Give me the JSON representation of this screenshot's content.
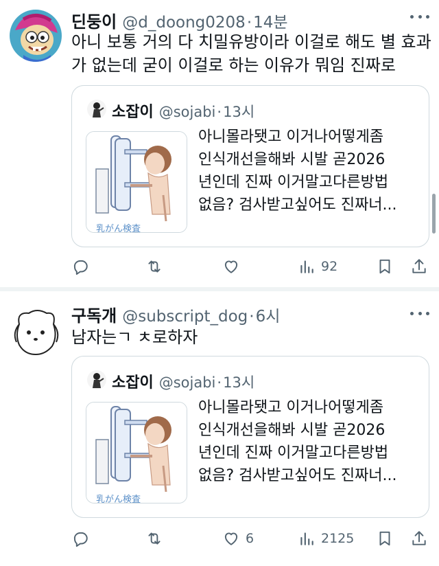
{
  "tweets": [
    {
      "author_name": "딘둥이",
      "handle": "@d_doong0208",
      "separator": "·",
      "time": "14분",
      "text_lines": [
        "아니 보통 거의 다 치밀유방이라 이걸로 해도 별 효과",
        "가 없는데 굳이 이걸로 하는 이유가 뭐임 진짜로"
      ],
      "quote": {
        "author_name": "소잡이",
        "handle": "@sojabi",
        "separator": "·",
        "time": "13시",
        "media_caption": "乳がん検査",
        "text_lines": [
          "아니몰라됏고 이거나어떻게좀",
          "인식개선을해봐 시발  곧2026",
          "년인데 진짜 이거말고다른방법",
          "없음?  검사받고싶어도 진짜너..."
        ]
      },
      "actions": {
        "replies": "",
        "retweets": "",
        "likes": "",
        "views": "92"
      }
    },
    {
      "author_name": "구독개",
      "handle": "@subscript_dog",
      "separator": "·",
      "time": "6시",
      "text_lines": [
        "남자는ㄱ ㅊ로하자"
      ],
      "quote": {
        "author_name": "소잡이",
        "handle": "@sojabi",
        "separator": "·",
        "time": "13시",
        "media_caption": "乳がん検査",
        "text_lines": [
          "아니몰라됏고 이거나어떻게좀",
          "인식개선을해봐 시발  곧2026",
          "년인데 진짜 이거말고다른방법",
          "없음?  검사받고싶어도 진짜너..."
        ]
      },
      "actions": {
        "replies": "",
        "retweets": "",
        "likes": "6",
        "views": "2125"
      }
    }
  ],
  "icons": {
    "more": "more-horizontal-icon",
    "reply": "reply-icon",
    "retweet": "retweet-icon",
    "like": "heart-icon",
    "views": "views-bar-chart-icon",
    "bookmark": "bookmark-icon",
    "share": "share-icon"
  },
  "colors": {
    "text": "#0f1419",
    "muted": "#536471",
    "border": "#cfd9de",
    "divider": "#eff3f4"
  }
}
